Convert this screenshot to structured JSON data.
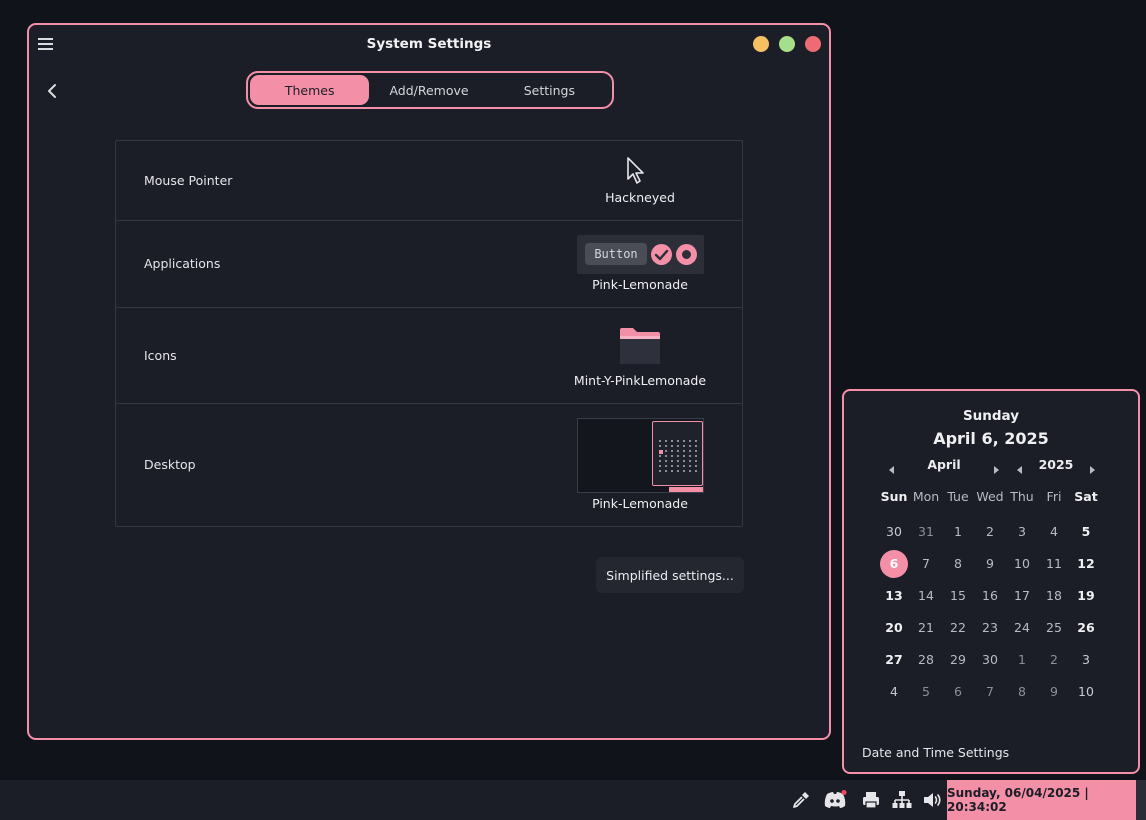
{
  "window": {
    "title": "System Settings",
    "tabs": [
      {
        "label": "Themes",
        "active": true
      },
      {
        "label": "Add/Remove",
        "active": false
      },
      {
        "label": "Settings",
        "active": false
      }
    ]
  },
  "themes": [
    {
      "label": "Mouse Pointer",
      "value": "Hackneyed"
    },
    {
      "label": "Applications",
      "value": "Pink-Lemonade",
      "preview_button": "Button"
    },
    {
      "label": "Icons",
      "value": "Mint-Y-PinkLemonade"
    },
    {
      "label": "Desktop",
      "value": "Pink-Lemonade"
    }
  ],
  "simplified_button": "Simplified settings...",
  "calendar": {
    "day_name": "Sunday",
    "full_date": "April 6, 2025",
    "month": "April",
    "year": "2025",
    "weekdays": [
      "Sun",
      "Mon",
      "Tue",
      "Wed",
      "Thu",
      "Fri",
      "Sat"
    ],
    "weeks": [
      [
        "30",
        "31",
        "1",
        "2",
        "3",
        "4",
        "5"
      ],
      [
        "6",
        "7",
        "8",
        "9",
        "10",
        "11",
        "12"
      ],
      [
        "13",
        "14",
        "15",
        "16",
        "17",
        "18",
        "19"
      ],
      [
        "20",
        "21",
        "22",
        "23",
        "24",
        "25",
        "26"
      ],
      [
        "27",
        "28",
        "29",
        "30",
        "1",
        "2",
        "3"
      ],
      [
        "4",
        "5",
        "6",
        "7",
        "8",
        "9",
        "10"
      ]
    ],
    "today": "6",
    "settings_link": "Date and Time Settings"
  },
  "taskbar": {
    "clock": "Sunday, 06/04/2025 | 20:34:02",
    "tray_icons": [
      "color-picker-icon",
      "discord-icon",
      "printer-icon",
      "network-icon",
      "volume-icon"
    ]
  },
  "colors": {
    "accent": "#f48fa8",
    "window_bg": "#1b1e27",
    "desktop_bg": "#10131a",
    "minimize": "#f5c062",
    "maximize": "#a6de8a",
    "close": "#ef6b74"
  }
}
